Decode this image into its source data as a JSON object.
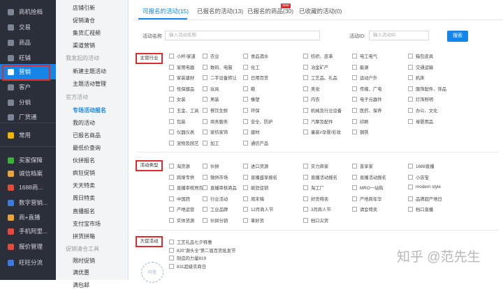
{
  "nav": {
    "items": [
      {
        "label": "商机抢档",
        "color": "#7d8594"
      },
      {
        "label": "交易",
        "color": "#7d8594"
      },
      {
        "label": "商品",
        "color": "#7d8594"
      },
      {
        "label": "旺铺",
        "color": "#7d8594"
      },
      {
        "label": "营销",
        "color": "#ffffff"
      },
      {
        "label": "客户",
        "color": "#7d8594"
      },
      {
        "label": "分销",
        "color": "#7d8594"
      },
      {
        "label": "厂货通",
        "color": "#7d8594"
      },
      {
        "label": "常用",
        "color": "#f4b400"
      },
      {
        "label": "买家保障",
        "color": "#3bb33b"
      },
      {
        "label": "诚信档案",
        "color": "#e8a33c"
      },
      {
        "label": "1688商...",
        "color": "#e24a3b"
      },
      {
        "label": "数字营销...",
        "color": "#3b7be0"
      },
      {
        "label": "商+直播",
        "color": "#e8a33c"
      },
      {
        "label": "手机阿里...",
        "color": "#e24a3b"
      },
      {
        "label": "报价管理",
        "color": "#e24a3b"
      },
      {
        "label": "旺旺分流",
        "color": "#3b7be0"
      }
    ]
  },
  "subnav": {
    "items": [
      {
        "label": "店铺引新",
        "kind": "item"
      },
      {
        "label": "促销清仓",
        "kind": "item"
      },
      {
        "label": "集货汇视频",
        "kind": "item"
      },
      {
        "label": "渠道营销",
        "kind": "item"
      },
      {
        "label": "我发起的活动",
        "kind": "group"
      },
      {
        "label": "新建主题活动",
        "kind": "item"
      },
      {
        "label": "主题活动管理",
        "kind": "item"
      },
      {
        "label": "官方活动",
        "kind": "group"
      },
      {
        "label": "专场活动报名",
        "kind": "selected"
      },
      {
        "label": "我的活动",
        "kind": "item"
      },
      {
        "label": "已报名商品",
        "kind": "item"
      },
      {
        "label": "最低价查询",
        "kind": "item"
      },
      {
        "label": "伙拼报名",
        "kind": "item"
      },
      {
        "label": "疯狂促销",
        "kind": "item"
      },
      {
        "label": "天天特卖",
        "kind": "item"
      },
      {
        "label": "周日特卖",
        "kind": "item"
      },
      {
        "label": "直播报名",
        "kind": "item"
      },
      {
        "label": "支付宝市场",
        "kind": "item"
      },
      {
        "label": "拼货拼箱",
        "kind": "item"
      },
      {
        "label": "促销清仓工具",
        "kind": "group"
      },
      {
        "label": "限时促销",
        "kind": "item"
      },
      {
        "label": "满优惠",
        "kind": "item"
      },
      {
        "label": "满包邮",
        "kind": "item"
      }
    ]
  },
  "tabs": [
    {
      "label": "可报名的活动(15)"
    },
    {
      "label": "已报名的活动(13)"
    },
    {
      "label": "已报名的商品(30)"
    },
    {
      "label": "已收藏的活动(0)"
    }
  ],
  "new_badge": "new",
  "search": {
    "name_label": "活动名称",
    "name_placeholder": "输入活动名称",
    "id_label": "活动ID:",
    "id_placeholder": "输入活动ID",
    "button": "搜索"
  },
  "sections": [
    {
      "title": "主营行业",
      "options": [
        "小杆/家道",
        "农业",
        "食品酒水",
        "纺织、皮革",
        "电工电气",
        "箱包皮具",
        "家用电器",
        "数码、电脑",
        "化工",
        "冶金矿产",
        "能源",
        "交通运输",
        "家装建材",
        "二手设备转让",
        "日用百货",
        "工艺品、礼品",
        "运动户外",
        "机床",
        "性保健品",
        "玩具",
        "鞋",
        "美妆",
        "传媒、广电",
        "服饰配件、饰品",
        "女装",
        "男装",
        "橡塑",
        "内衣",
        "电子元器件",
        "灯饰照明",
        "五金、工具",
        "餐饮生鲜",
        "环保",
        "机械及行业设备",
        "医药、保养",
        "办公、文化",
        "包装",
        "商务服务",
        "安全、防护",
        "汽摩及配件",
        "印刷",
        "母婴用品",
        "仪器仪表",
        "家纺家饰",
        "建材",
        "童装\\/孕婴/彩妆",
        "钢铁",
        "",
        "宠物及园艺",
        "加工",
        "通信产品",
        "",
        "",
        ""
      ]
    },
    {
      "title": "活动类型",
      "options": [
        "淘货源",
        "伙拼",
        "进口货源",
        "实力商家",
        "普享家",
        "1688直播",
        "跨境专供",
        "微供市场",
        "直播盛享报名",
        "直播活动报名",
        "直播活动报名",
        "小店宝",
        "直播审核预告",
        "直播审核商品",
        "疯狂促销",
        "淘工厂",
        "MRO一站购",
        "modern style",
        "中国团",
        "行业活动",
        "周末嗨",
        "好货特卖",
        "产地商年华",
        "品牌超产地日",
        "产地运营",
        "工业品牌",
        "12月商人节",
        "3月商人节",
        "请会特卖",
        "档口直播",
        "实体货源",
        "伙拼分销",
        "拿好货",
        "档口尖货",
        "",
        ""
      ]
    },
    {
      "title": "大促活动",
      "options": [
        "工艺礼品七夕特惠",
        "820\"源头全\"第二届百货批发节",
        "制造的力量819",
        "831超级实商日"
      ]
    }
  ],
  "watermark": "知乎 @范先生",
  "stamp_text": "阿里"
}
